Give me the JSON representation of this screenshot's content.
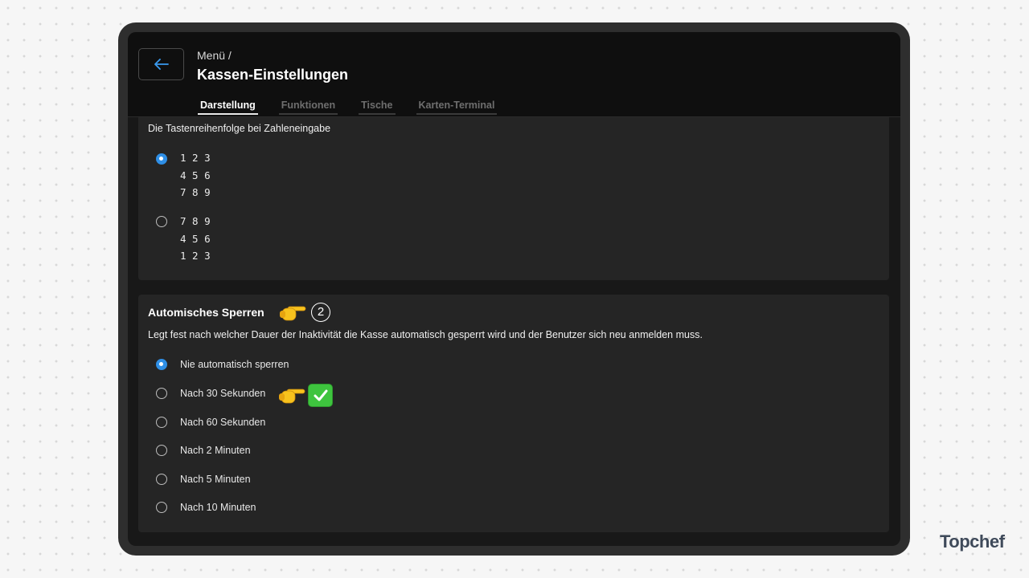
{
  "header": {
    "breadcrumb": "Menü /",
    "title": "Kassen-Einstellungen",
    "back_icon": "arrow-left-icon"
  },
  "tabs": [
    {
      "label": "Darstellung",
      "active": true
    },
    {
      "label": "Funktionen",
      "active": false
    },
    {
      "label": "Tische",
      "active": false
    },
    {
      "label": "Karten-Terminal",
      "active": false
    }
  ],
  "keypad_section": {
    "description": "Die Tastenreihenfolge bei Zahleneingabe",
    "options": [
      {
        "rows": [
          "1 2 3",
          "4 5 6",
          "7 8 9"
        ],
        "selected": true
      },
      {
        "rows": [
          "7 8 9",
          "4 5 6",
          "1 2 3"
        ],
        "selected": false
      }
    ]
  },
  "lock_section": {
    "title": "Automisches Sperren",
    "step_badge": "2",
    "description": "Legt fest nach welcher Dauer der Inaktivität die Kasse automatisch gesperrt wird und der Benutzer sich neu anmelden muss.",
    "options": [
      {
        "label": "Nie automatisch sperren",
        "selected": true
      },
      {
        "label": "Nach 30 Sekunden",
        "selected": false
      },
      {
        "label": "Nach 60 Sekunden",
        "selected": false
      },
      {
        "label": "Nach 2 Minuten",
        "selected": false
      },
      {
        "label": "Nach 5 Minuten",
        "selected": false
      },
      {
        "label": "Nach 10 Minuten",
        "selected": false
      }
    ]
  },
  "brand": {
    "logo_text": "Topchef"
  },
  "colors": {
    "accent": "#2f8fe6",
    "background": "#181818",
    "card": "#252525",
    "check_green": "#3ec43e"
  }
}
